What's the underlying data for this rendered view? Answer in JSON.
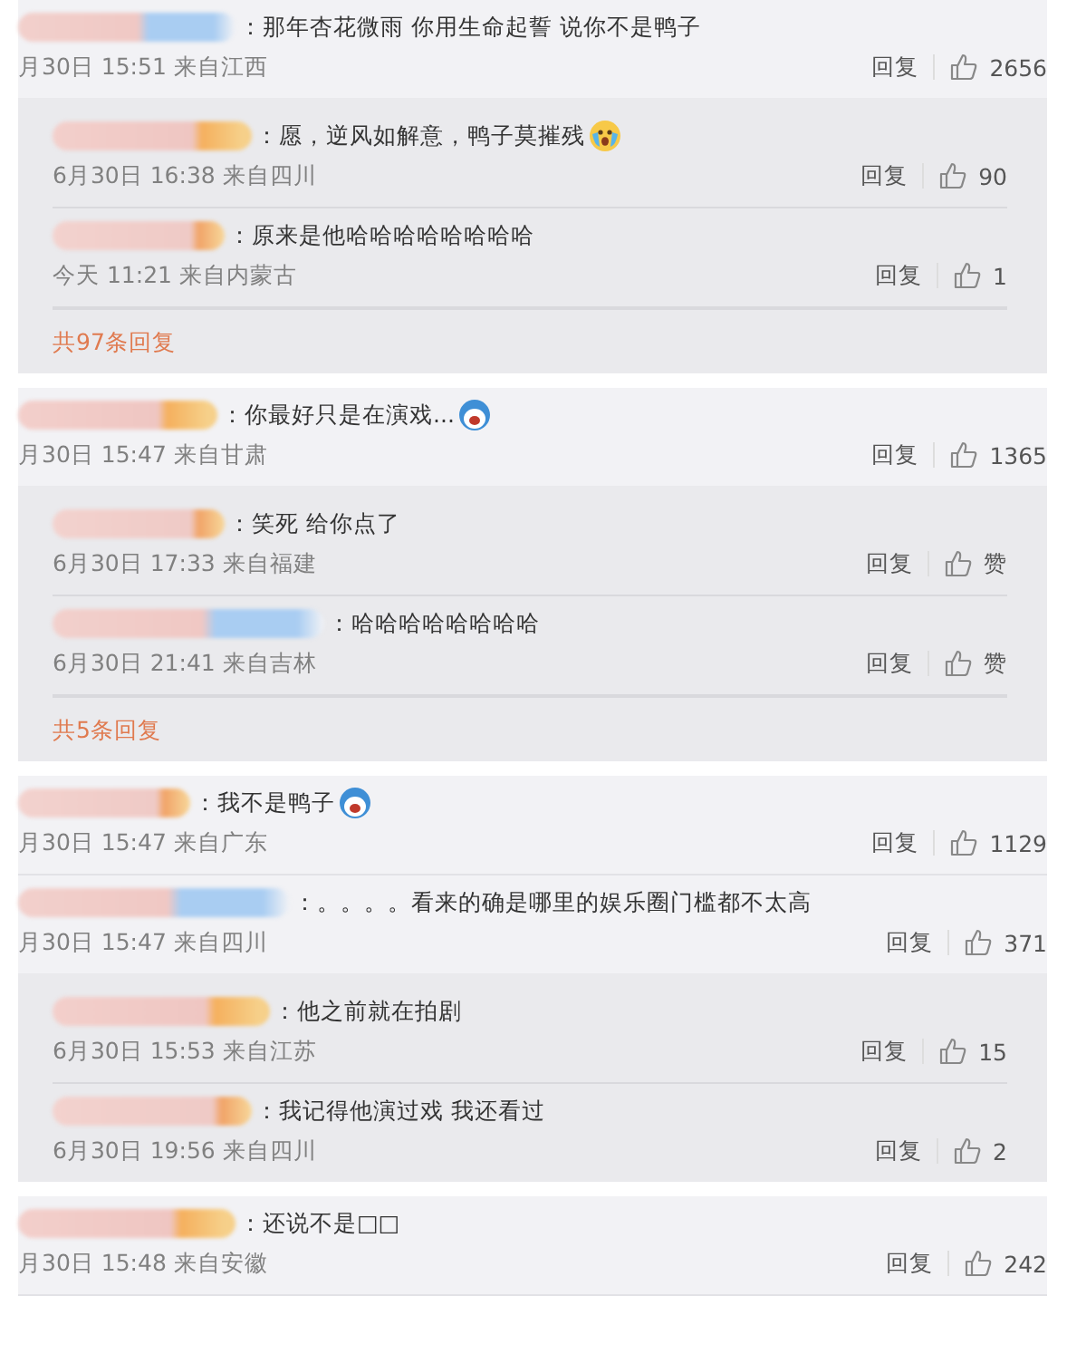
{
  "comments": [
    {
      "kind": "plain",
      "text": "：那年杏花微雨 你用生命起誓 说你不是鸭子",
      "meta": "月30日 15:51 来自江西",
      "reply_label": "回复",
      "likes": "2656",
      "replies": [
        {
          "kind": "scared",
          "text": "：愿，逆风如解意，鸭子莫摧残",
          "meta": "6月30日 16:38 来自四川",
          "reply_label": "回复",
          "likes": "90"
        },
        {
          "kind": "plain",
          "text": "：原来是他哈哈哈哈哈哈哈哈",
          "meta": "今天 11:21 来自内蒙古",
          "reply_label": "回复",
          "likes": "1"
        }
      ],
      "replies_footer": "共97条回复"
    },
    {
      "kind": "round",
      "text": "：你最好只是在演戏...",
      "meta": "月30日 15:47 来自甘肃",
      "reply_label": "回复",
      "likes": "1365",
      "replies": [
        {
          "kind": "plain",
          "text": "：笑死 给你点了",
          "meta": "6月30日 17:33 来自福建",
          "reply_label": "回复",
          "likes": "赞"
        },
        {
          "kind": "plain",
          "text": "：哈哈哈哈哈哈哈哈",
          "meta": "6月30日 21:41 来自吉林",
          "reply_label": "回复",
          "likes": "赞"
        }
      ],
      "replies_footer": "共5条回复"
    },
    {
      "kind": "round",
      "text": "：我不是鸭子",
      "meta": "月30日 15:47 来自广东",
      "reply_label": "回复",
      "likes": "1129"
    },
    {
      "kind": "plain",
      "text": "：。。。。看来的确是哪里的娱乐圈门槛都不太高",
      "meta": "月30日 15:47 来自四川",
      "reply_label": "回复",
      "likes": "371",
      "replies": [
        {
          "kind": "plain",
          "text": "：他之前就在拍剧",
          "meta": "6月30日 15:53 来自江苏",
          "reply_label": "回复",
          "likes": "15"
        },
        {
          "kind": "plain",
          "text": "：我记得他演过戏 我还看过",
          "meta": "6月30日 19:56 来自四川",
          "reply_label": "回复",
          "likes": "2"
        }
      ]
    },
    {
      "kind": "plain",
      "text": "：还说不是□□",
      "meta": "月30日 15:48 来自安徽",
      "reply_label": "回复",
      "likes": "242"
    }
  ]
}
